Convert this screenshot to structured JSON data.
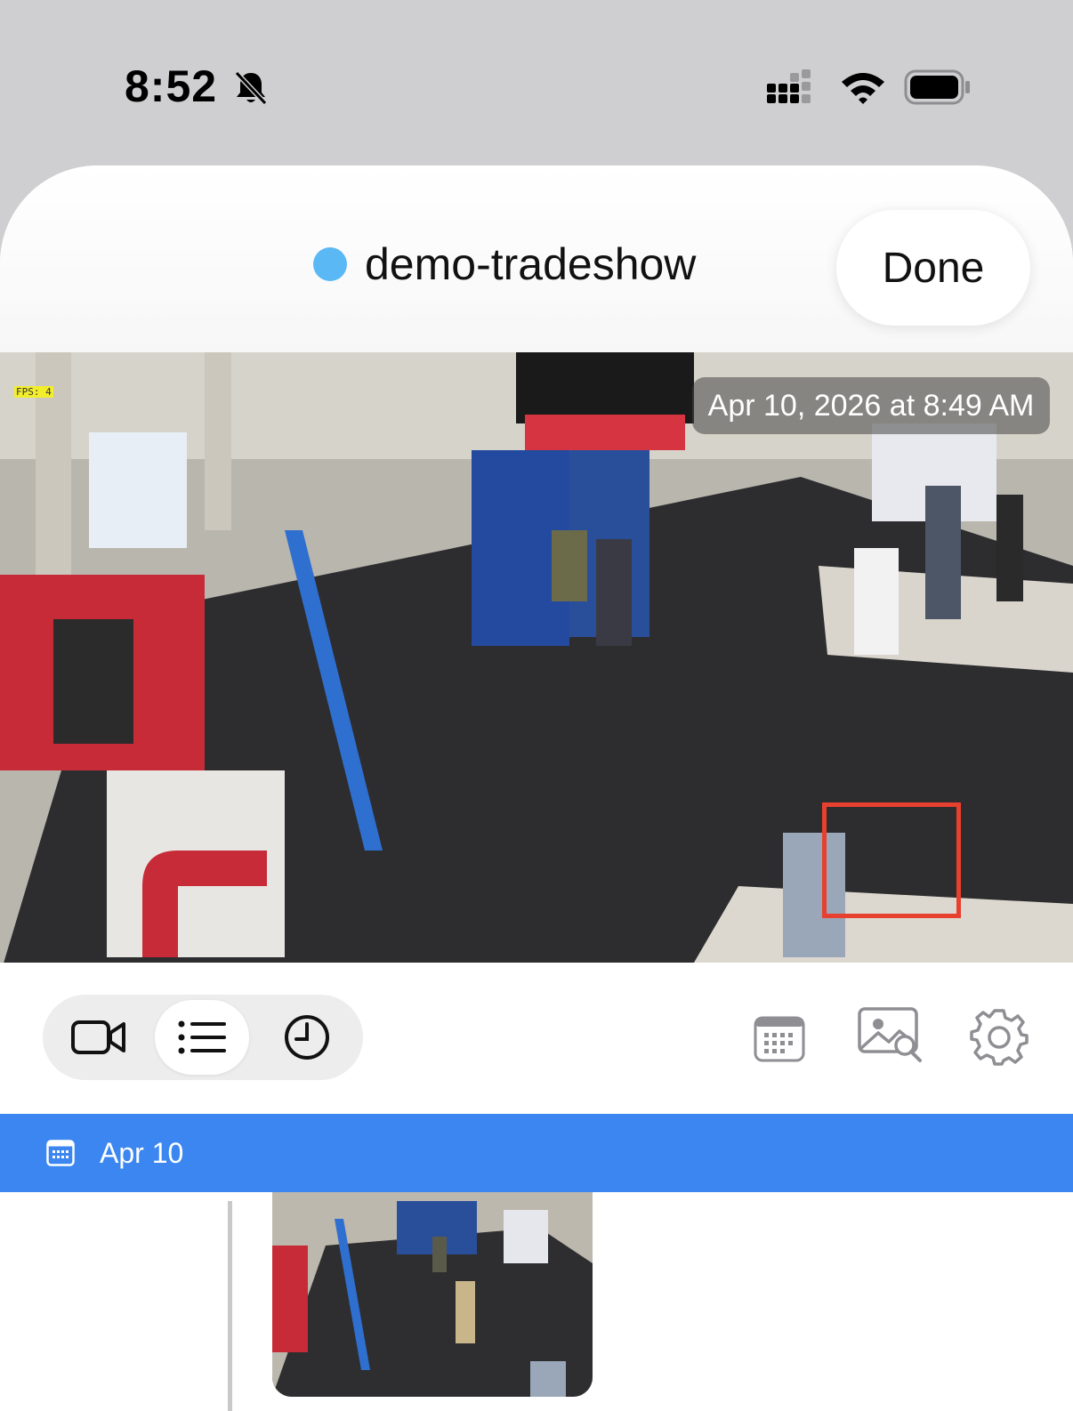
{
  "status_bar": {
    "time": "8:52",
    "icons": [
      "bell-slash-icon",
      "cellular-signal-icon",
      "wifi-icon",
      "battery-icon"
    ]
  },
  "header": {
    "camera_name": "demo-tradeshow",
    "live_dot_color": "#5ab8f5",
    "done_label": "Done"
  },
  "video": {
    "fps_label": "FPS: 4",
    "timestamp": "Apr 10, 2026 at 8:49 AM"
  },
  "toolbar": {
    "segments": [
      {
        "icon": "video-camera-icon",
        "active": false
      },
      {
        "icon": "list-icon",
        "active": true
      },
      {
        "icon": "clock-icon",
        "active": false
      }
    ],
    "actions": [
      "calendar-icon",
      "image-search-icon",
      "gear-icon"
    ],
    "highlight_color": "#e8402e"
  },
  "date_section": {
    "label": "Apr 10",
    "color": "#3b86f0"
  }
}
